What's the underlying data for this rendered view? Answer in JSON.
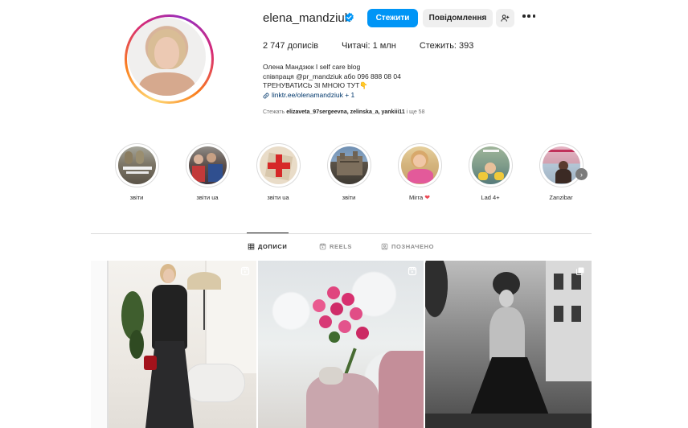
{
  "profile": {
    "username": "elena_mandziuk",
    "verified_icon": "verified-badge-icon",
    "follow_label": "Стежити",
    "message_label": "Повідомлення",
    "add_user_icon": "add-user-icon",
    "more_icon": "more-options-icon",
    "stats": {
      "posts": "2 747 дописів",
      "followers": "Читачі: 1 млн",
      "following": "Стежить: 393"
    },
    "bio": {
      "line1": "Олена Мандзюк I self care blog",
      "line2": "співпраця @pr_mandziuk або 096 888 08 04",
      "line3": "ТРЕНУВАТИСЬ ЗІ МНОЮ ТУТ👇",
      "link": "linktr.ee/olenamandziuk + 1"
    },
    "followed_by": {
      "prefix": "Стежать ",
      "names": "elizaveta_97sergeevna, zelinska_a, yankiii11",
      "suffix": " і ще 58"
    }
  },
  "highlights": [
    {
      "label": "звіти"
    },
    {
      "label": "звіти ua"
    },
    {
      "label": "звіти ua"
    },
    {
      "label": "звіти"
    },
    {
      "label": "Mirra",
      "emoji": "❤️"
    },
    {
      "label": "Lad 4+"
    },
    {
      "label": "Zanzibar"
    }
  ],
  "highlights_next_icon": "chevron-right-icon",
  "tabs": [
    {
      "label": "ДОПИСИ",
      "icon": "grid-icon",
      "active": true
    },
    {
      "label": "REELS",
      "icon": "reels-icon",
      "active": false
    },
    {
      "label": "ПОЗНАЧЕНО",
      "icon": "tagged-icon",
      "active": false
    }
  ],
  "posts": [
    {
      "badge": "reels-icon"
    },
    {
      "badge": "reels-icon"
    },
    {
      "badge": "carousel-icon"
    }
  ],
  "colors": {
    "accent": "#0095f6",
    "text": "#262626",
    "muted": "#737373",
    "link": "#00376b"
  }
}
